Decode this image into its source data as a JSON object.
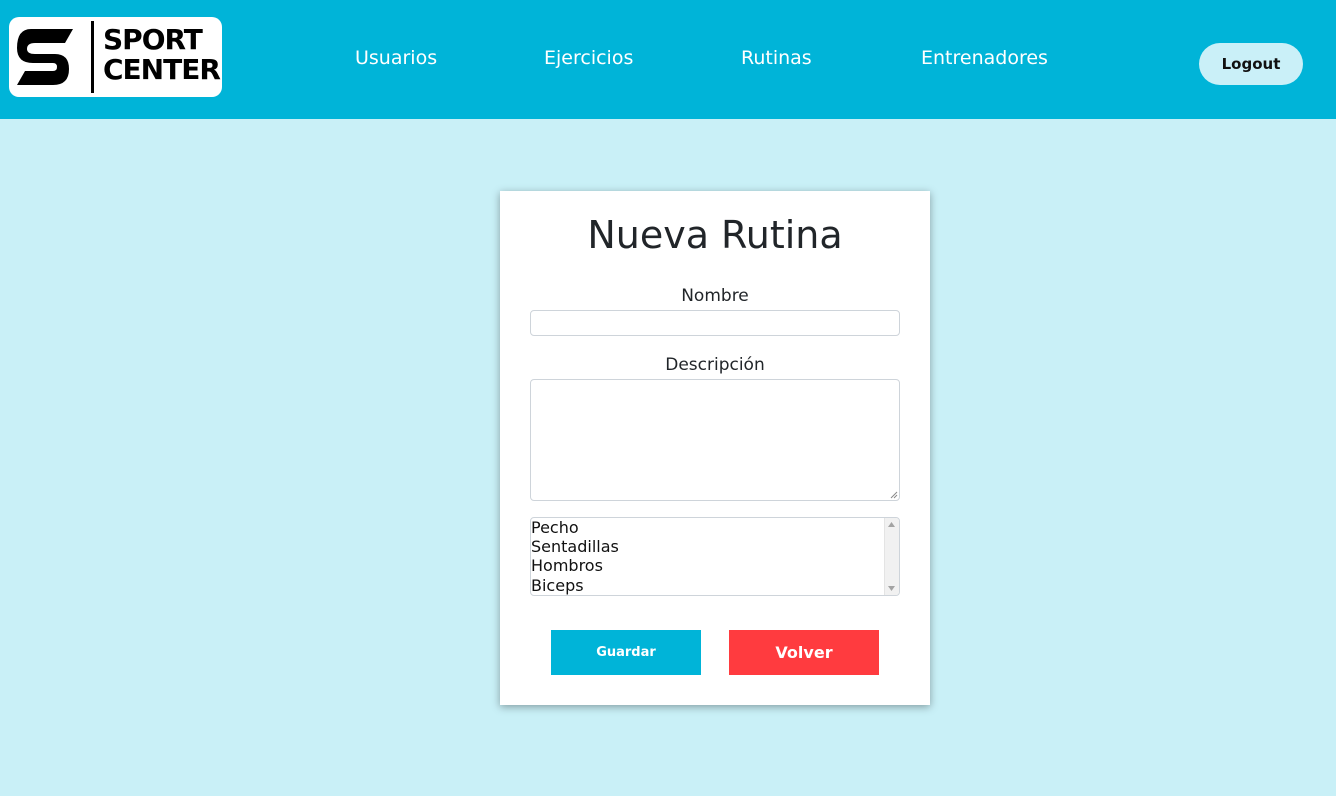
{
  "header": {
    "logo": {
      "line1": "SPORT",
      "line2": "CENTER",
      "mark_icon": "s-logo-icon"
    },
    "nav": [
      {
        "label": "Usuarios"
      },
      {
        "label": "Ejercicios"
      },
      {
        "label": "Rutinas"
      },
      {
        "label": "Entrenadores"
      }
    ],
    "logout_label": "Logout"
  },
  "form": {
    "title": "Nueva Rutina",
    "nombre_label": "Nombre",
    "nombre_value": "",
    "descripcion_label": "Descripción",
    "descripcion_value": "",
    "exercise_options": [
      "Pecho",
      "Sentadillas",
      "Hombros",
      "Biceps"
    ],
    "save_label": "Guardar",
    "back_label": "Volver"
  },
  "colors": {
    "header_bg": "#00b4d8",
    "page_bg": "#c9f0f7",
    "save_button": "#00b4d8",
    "back_button": "#ff3b3f",
    "logout_button": "#caf0f8"
  }
}
